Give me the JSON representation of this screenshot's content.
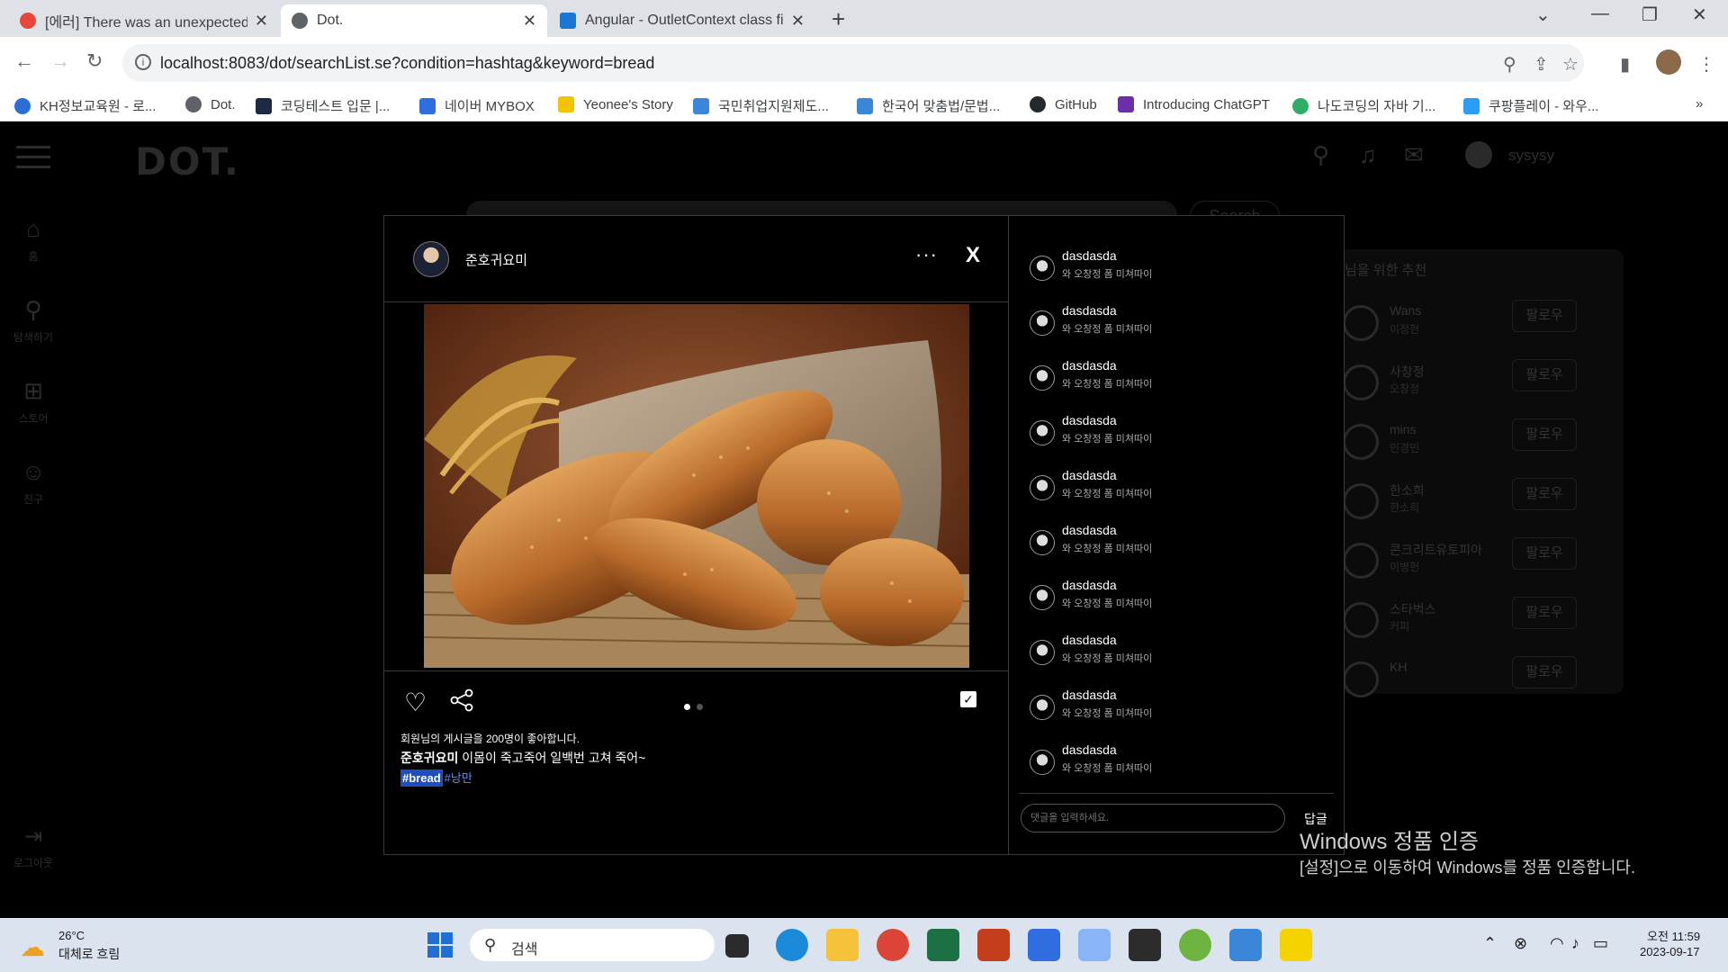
{
  "browser": {
    "tabs": [
      {
        "title": "[에러] There was an unexpected",
        "favicon_color": "#e8453c"
      },
      {
        "title": "Dot.",
        "favicon_color": "#5f6368"
      },
      {
        "title": "Angular - OutletContext class fi",
        "favicon_color": "#1976d2"
      }
    ],
    "url": "localhost:8083/dot/searchList.se?condition=hashtag&keyword=bread",
    "bookmarks": [
      {
        "label": "KH정보교육원 - 로...",
        "color": "#2a6fd8"
      },
      {
        "label": "Dot.",
        "color": "#5f6368"
      },
      {
        "label": "코딩테스트 입문 |...",
        "color": "#1e2a44"
      },
      {
        "label": "네이버 MYBOX",
        "color": "#2f6de1"
      },
      {
        "label": "Yeonee's Story",
        "color": "#f3c200"
      },
      {
        "label": "국민취업지원제도...",
        "color": "#3a86d8"
      },
      {
        "label": "한국어 맞춤법/문법...",
        "color": "#3a86d8"
      },
      {
        "label": "GitHub",
        "color": "#24292f"
      },
      {
        "label": "Introducing ChatGPT",
        "color": "#6b2fa8"
      },
      {
        "label": "나도코딩의 자바 기...",
        "color": "#2fae66"
      },
      {
        "label": "쿠팡플레이 - 와우...",
        "color": "#2a9df4"
      }
    ],
    "more_bookmarks": "»"
  },
  "site": {
    "logo": "DOT.",
    "sidebar": [
      {
        "icon": "home-icon",
        "label": "홈"
      },
      {
        "icon": "search-icon",
        "label": "탐색하기"
      },
      {
        "icon": "plus-square-icon",
        "label": "스토어"
      },
      {
        "icon": "friends-icon",
        "label": "친구"
      }
    ],
    "logout_label": "로그아웃",
    "username": "sysysy",
    "search_button": "Search",
    "recommend_title": "님을 위한 추천",
    "recommendations": [
      {
        "name": "Wans",
        "sub": "이정현",
        "follow": "팔로우"
      },
      {
        "name": "사창정",
        "sub": "오창정",
        "follow": "팔로우"
      },
      {
        "name": "mins",
        "sub": "민경민",
        "follow": "팔로우"
      },
      {
        "name": "한소희",
        "sub": "한소희",
        "follow": "팔로우"
      },
      {
        "name": "콘크리트유토피아",
        "sub": "이병헌",
        "follow": "팔로우"
      },
      {
        "name": "스타벅스",
        "sub": "커피",
        "follow": "팔로우"
      },
      {
        "name": "KH",
        "sub": "",
        "follow": "팔로우"
      }
    ]
  },
  "modal": {
    "author": "준호귀요미",
    "more": "···",
    "close": "X",
    "likes_text": "회원님의 게시글을 200명이 좋아합니다.",
    "caption_author": "준호귀요미",
    "caption_text": " 이몸이 죽고죽어 일백번 고쳐 죽어~",
    "tags": [
      "#bread",
      "#낭만"
    ],
    "comments": [
      {
        "user": "dasdasda",
        "text": "와 오창정 폼 미쳐따이"
      },
      {
        "user": "dasdasda",
        "text": "와 오창정 폼 미쳐따이"
      },
      {
        "user": "dasdasda",
        "text": "와 오창정 폼 미쳐따이"
      },
      {
        "user": "dasdasda",
        "text": "와 오창정 폼 미쳐따이"
      },
      {
        "user": "dasdasda",
        "text": "와 오창정 폼 미쳐따이"
      },
      {
        "user": "dasdasda",
        "text": "와 오창정 폼 미쳐따이"
      },
      {
        "user": "dasdasda",
        "text": "와 오창정 폼 미쳐따이"
      },
      {
        "user": "dasdasda",
        "text": "와 오창정 폼 미쳐따이"
      },
      {
        "user": "dasdasda",
        "text": "와 오창정 폼 미쳐따이"
      },
      {
        "user": "dasdasda",
        "text": "와 오창정 폼 미쳐따이"
      }
    ],
    "comment_placeholder": "댓글을 입력하세요.",
    "reply_label": "답글"
  },
  "windows": {
    "activation_title": "Windows 정품 인증",
    "activation_text": "[설정]으로 이동하여 Windows를 정품 인증합니다.",
    "weather_temp": "26°C",
    "weather_desc": "대체로 흐림",
    "search_label": "검색",
    "time": "오전 11:59",
    "date": "2023-09-17"
  }
}
